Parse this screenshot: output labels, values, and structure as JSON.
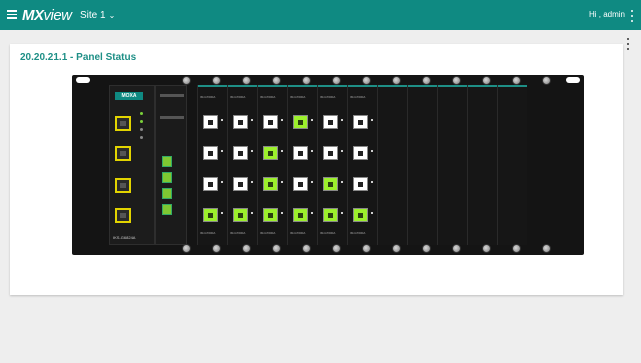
{
  "app": {
    "logo_bold": "MX",
    "logo_thin": "view",
    "site": "Site 1",
    "user_greeting": "Hi , admin"
  },
  "panel": {
    "title": "20.20.21.1 - Panel Status",
    "brand": "MOXA",
    "model": "IKS-G6824A",
    "slot_label": "IM-G7000A",
    "port_slots": [
      {
        "ports": [
          "off",
          "off",
          "off",
          "on"
        ]
      },
      {
        "ports": [
          "off",
          "off",
          "off",
          "on"
        ]
      },
      {
        "ports": [
          "off",
          "on",
          "on",
          "on"
        ]
      },
      {
        "ports": [
          "on",
          "off",
          "off",
          "on"
        ]
      },
      {
        "ports": [
          "off",
          "off",
          "on",
          "on"
        ]
      },
      {
        "ports": [
          "off",
          "off",
          "off",
          "on"
        ]
      }
    ],
    "empty_slot_count": 5
  },
  "colors": {
    "header": "#0f8a82",
    "title": "#1e8f86",
    "port_active": "#9cf02c"
  }
}
